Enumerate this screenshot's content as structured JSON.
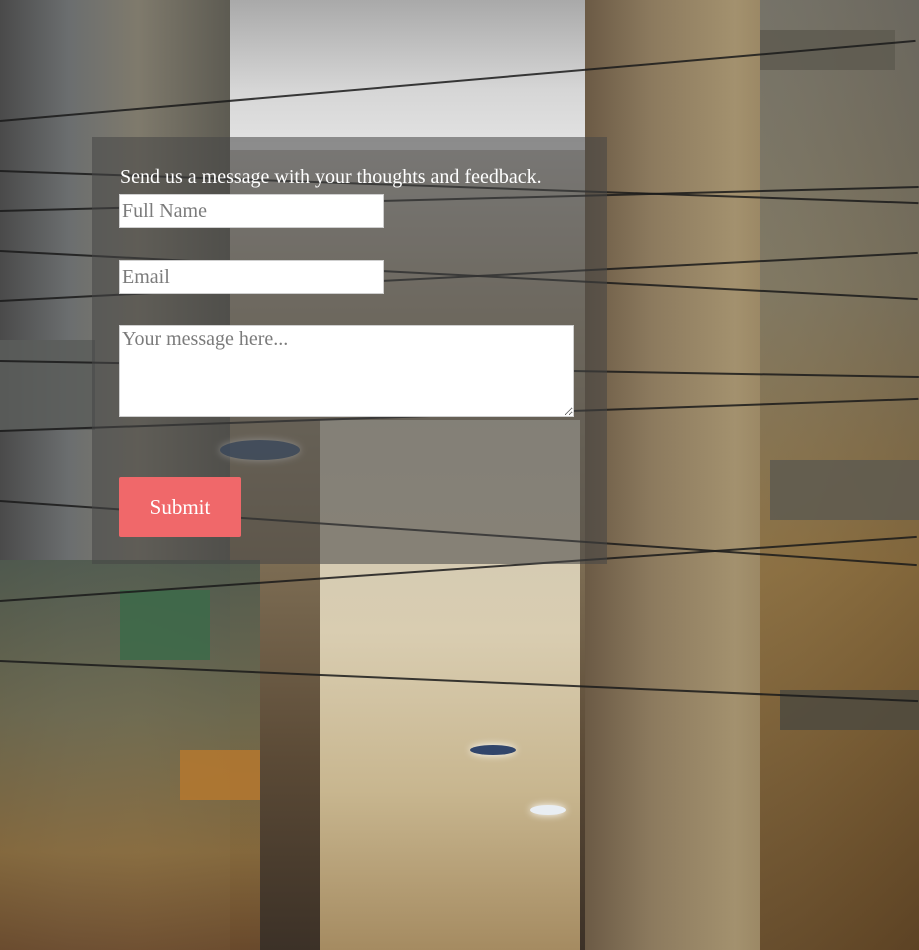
{
  "form": {
    "intro_text": "Send us a message with your thoughts and feedback.",
    "name_placeholder": "Full Name",
    "email_placeholder": "Email",
    "message_placeholder": "Your message here...",
    "submit_label": "Submit"
  },
  "colors": {
    "submit_background": "#f0686a",
    "overlay": "rgba(70,70,70,0.55)"
  }
}
